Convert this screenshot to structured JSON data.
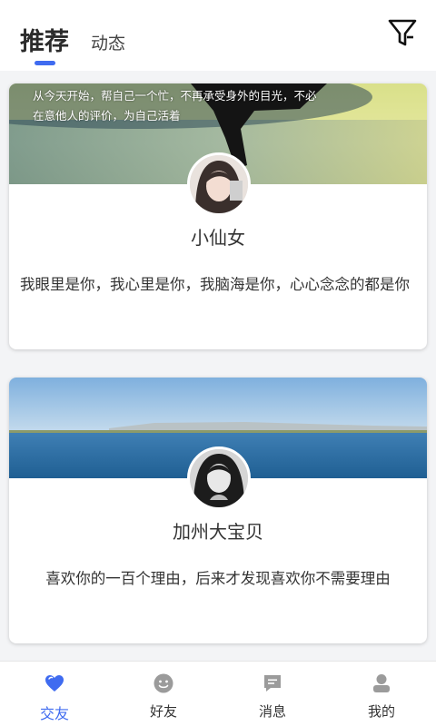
{
  "header": {
    "tabs": [
      {
        "label": "推荐",
        "active": true
      },
      {
        "label": "动态",
        "active": false
      }
    ],
    "filter_icon": "filter-icon"
  },
  "cards": [
    {
      "banner_text_line1": "从今天开始，帮自己一个忙，不再承受身外的目光，不必",
      "banner_text_line2": "在意他人的评价，为自己活着",
      "name": "小仙女",
      "bio": "我眼里是你，我心里是你，我脑海是你，心心念念的都是你"
    },
    {
      "name": "加州大宝贝",
      "bio": "喜欢你的一百个理由，后来才发现喜欢你不需要理由"
    }
  ],
  "tabbar": {
    "items": [
      {
        "label": "交友",
        "icon": "heart-icon",
        "active": true
      },
      {
        "label": "好友",
        "icon": "smiley-icon",
        "active": false
      },
      {
        "label": "消息",
        "icon": "chat-bubble-icon",
        "active": false
      },
      {
        "label": "我的",
        "icon": "user-icon",
        "active": false
      }
    ]
  },
  "colors": {
    "accent": "#3f6bf0",
    "background": "#f3f4f6",
    "icon_gray": "#9b9b9b"
  }
}
